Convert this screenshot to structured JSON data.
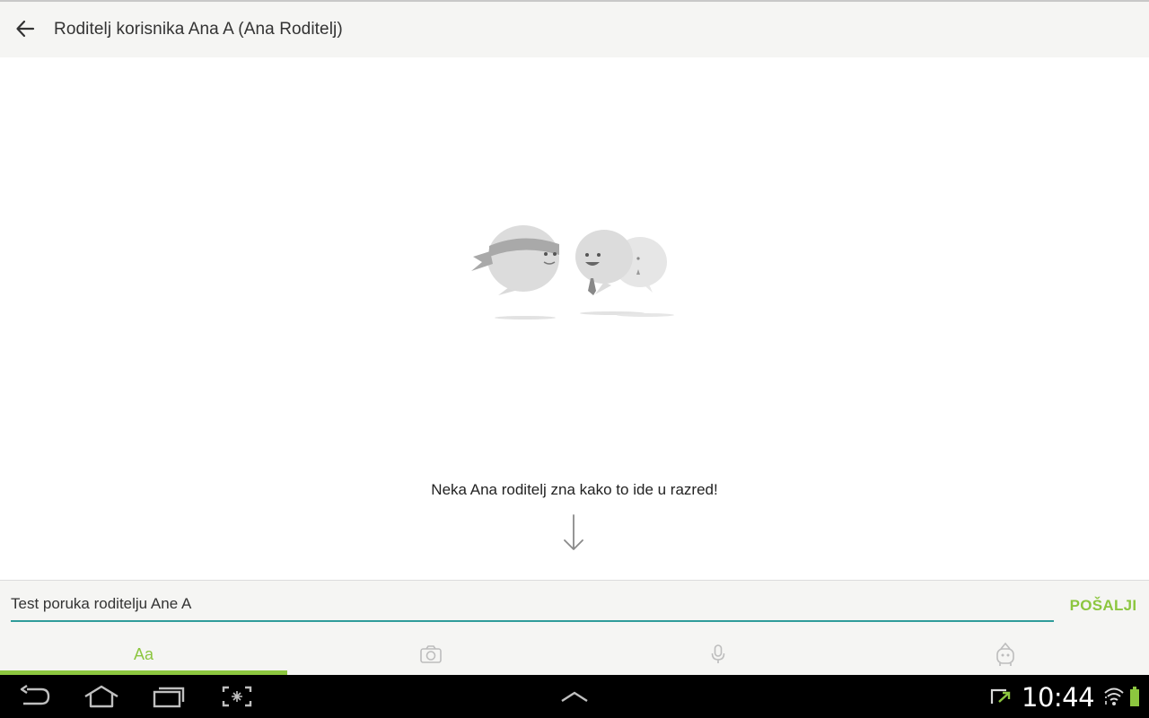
{
  "header": {
    "title": "Roditelj korisnika Ana A (Ana Roditelj)",
    "back_icon": "arrow-left-icon"
  },
  "empty_state": {
    "illustration": "chat-bubbles-illustration",
    "message": "Neka Ana roditelj zna kako to ide u razred!",
    "arrow_icon": "arrow-down-icon"
  },
  "composer": {
    "input_value": "Test poruka roditelju Ane A",
    "send_label": "POŠALJI",
    "accent_color": "#8cc63f",
    "input_underline_color": "#2f9c9a",
    "tabs": [
      {
        "label": "Aa",
        "icon": "text-icon",
        "selected": true
      },
      {
        "label": "",
        "icon": "camera-icon",
        "selected": false
      },
      {
        "label": "",
        "icon": "microphone-icon",
        "selected": false
      },
      {
        "label": "",
        "icon": "sticker-monster-icon",
        "selected": false
      }
    ]
  },
  "system_bar": {
    "time": "10:44",
    "icons": [
      "back-icon",
      "home-icon",
      "recent-apps-icon",
      "screenshot-icon",
      "chevron-up-icon",
      "sync-icon",
      "wifi-icon",
      "battery-icon"
    ]
  }
}
